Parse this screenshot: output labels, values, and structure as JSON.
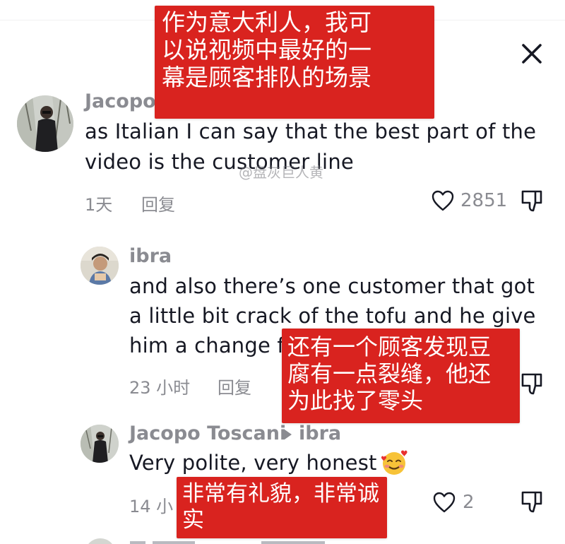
{
  "colors": {
    "overlay_red": "#d9231f",
    "text_primary": "#161823",
    "text_secondary": "#8a8b91"
  },
  "icons": {
    "close": "close-icon",
    "like": "heart-outline-icon",
    "dislike": "thumbs-down-icon",
    "reply_arrow": "caret-right-icon",
    "emoji": "smiling-face-with-hearts-emoji"
  },
  "watermark": "@盘灰巨人黄",
  "comments": [
    {
      "username": "Jacopo",
      "lines": [
        "as Italian I can say that the best part of the",
        "video is the customer line"
      ],
      "time": "1天",
      "reply_label": "回复",
      "likes": "2851",
      "translation": [
        "作为意大利人，我可",
        "以说视频中最好的一",
        "幕是顾客排队的场景"
      ]
    },
    {
      "username": "ibra",
      "lines": [
        "and also there’s one customer that got",
        "a little bit crack of the tofu and he give",
        "him a change f"
      ],
      "time": "23 小时",
      "reply_label": "回复",
      "translation": [
        "还有一个顾客发现豆",
        "腐有一点裂缝，他还",
        "为此找了零头"
      ]
    },
    {
      "username": "Jacopo Toscani",
      "reply_to": "ibra",
      "lines": [
        "Very polite, very honest"
      ],
      "time": "14 小时",
      "time_visible": "14 小",
      "likes": "2",
      "translation": [
        "非常有礼貌，非常诚",
        "实"
      ]
    }
  ]
}
